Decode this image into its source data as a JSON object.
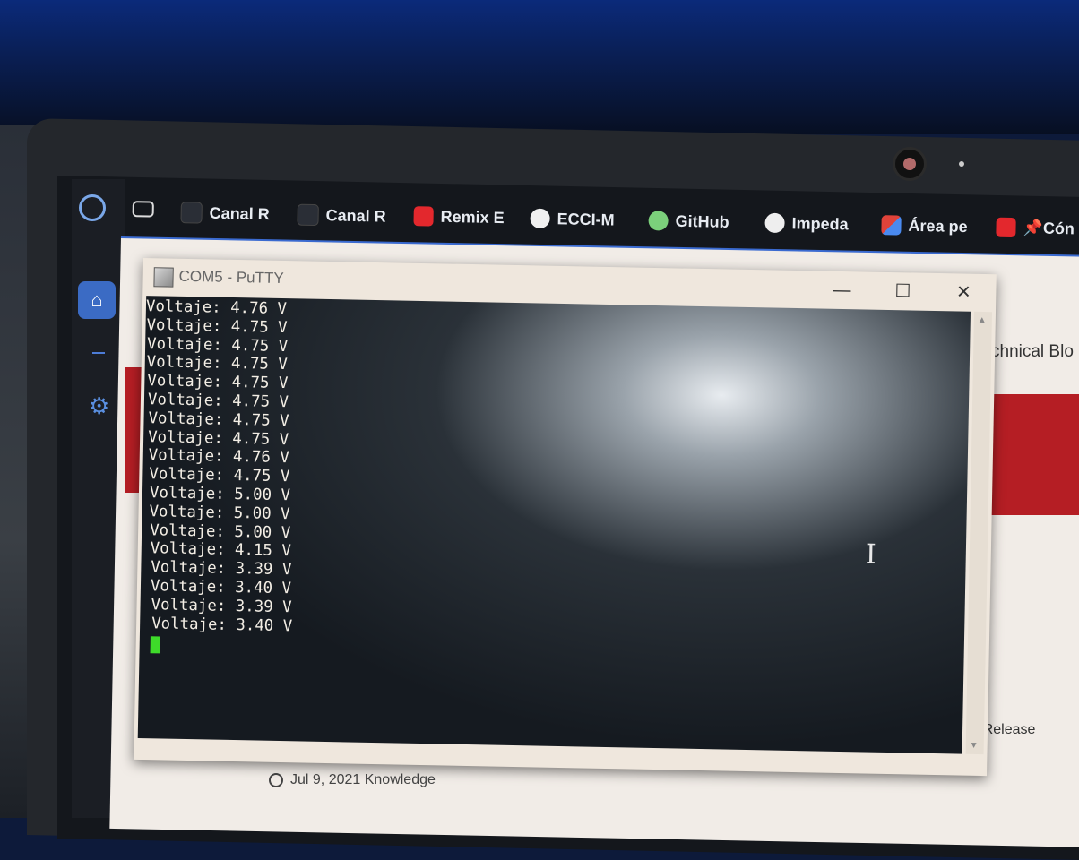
{
  "browser": {
    "tabs": [
      {
        "label": "Canal R",
        "icon": "video-icon"
      },
      {
        "label": "Canal R",
        "icon": "video-icon"
      },
      {
        "label": "Remix E",
        "icon": "youtube-icon"
      },
      {
        "label": "ECCI-M",
        "icon": "github-icon"
      },
      {
        "label": "GitHub",
        "icon": "github-icon"
      },
      {
        "label": "Impeda",
        "icon": "openai-icon"
      },
      {
        "label": "Área pe",
        "icon": "area-icon"
      },
      {
        "label": "📌Cón",
        "icon": "youtube-icon"
      }
    ]
  },
  "putty": {
    "title": "COM5 - PuTTY",
    "lines": [
      "Voltaje: 4.76 V",
      "Voltaje: 4.75 V",
      "Voltaje: 4.75 V",
      "Voltaje: 4.75 V",
      "Voltaje: 4.75 V",
      "Voltaje: 4.75 V",
      "Voltaje: 4.75 V",
      "Voltaje: 4.75 V",
      "Voltaje: 4.76 V",
      "Voltaje: 4.75 V",
      "Voltaje: 5.00 V",
      "Voltaje: 5.00 V",
      "Voltaje: 5.00 V",
      "Voltaje: 4.15 V",
      "Voltaje: 3.39 V",
      "Voltaje: 3.40 V",
      "Voltaje: 3.39 V",
      "Voltaje: 3.40 V"
    ]
  },
  "web": {
    "heading_fragment": "chnical Blo",
    "release_fragment": "the Release",
    "date_line": "Jul 9, 2021 Knowledge"
  },
  "colors": {
    "accent": "#3b6bc4",
    "cursor": "#3edb2a",
    "brand_red": "#b51e24"
  }
}
